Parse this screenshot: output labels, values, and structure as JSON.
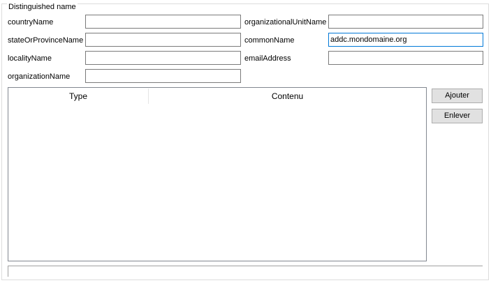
{
  "group": {
    "title": "Distinguished name"
  },
  "fields": {
    "countryName": {
      "label": "countryName",
      "value": ""
    },
    "stateOrProvinceName": {
      "label": "stateOrProvinceName",
      "value": ""
    },
    "localityName": {
      "label": "localityName",
      "value": ""
    },
    "organizationName": {
      "label": "organizationName",
      "value": ""
    },
    "organizationalUnitName": {
      "label": "organizationalUnitName",
      "value": ""
    },
    "commonName": {
      "label": "commonName",
      "value": "addc.mondomaine.org"
    },
    "emailAddress": {
      "label": "emailAddress",
      "value": ""
    }
  },
  "table": {
    "columns": [
      "Type",
      "Contenu"
    ],
    "rows": []
  },
  "buttons": {
    "add": "Ajouter",
    "remove": "Enlever"
  },
  "colors": {
    "focus_border": "#0078d7",
    "button_bg": "#e1e1e1"
  }
}
